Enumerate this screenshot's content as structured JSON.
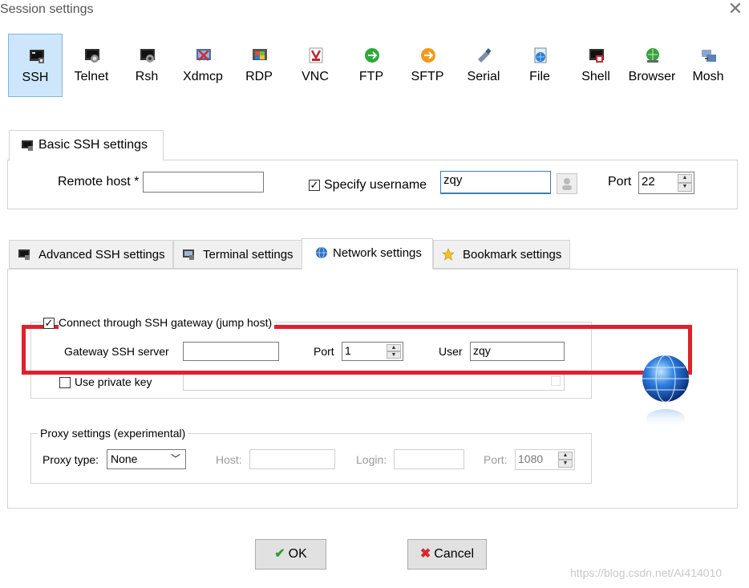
{
  "window": {
    "title": "Session settings"
  },
  "session_types": [
    {
      "label": "SSH",
      "icon": "ssh-terminal-icon",
      "selected": true
    },
    {
      "label": "Telnet",
      "icon": "telnet-icon"
    },
    {
      "label": "Rsh",
      "icon": "rsh-icon"
    },
    {
      "label": "Xdmcp",
      "icon": "xdmcp-icon"
    },
    {
      "label": "RDP",
      "icon": "rdp-icon"
    },
    {
      "label": "VNC",
      "icon": "vnc-icon"
    },
    {
      "label": "FTP",
      "icon": "ftp-icon"
    },
    {
      "label": "SFTP",
      "icon": "sftp-icon"
    },
    {
      "label": "Serial",
      "icon": "serial-icon"
    },
    {
      "label": "File",
      "icon": "file-icon"
    },
    {
      "label": "Shell",
      "icon": "shell-icon"
    },
    {
      "label": "Browser",
      "icon": "browser-icon"
    },
    {
      "label": "Mosh",
      "icon": "mosh-icon"
    }
  ],
  "basic": {
    "tab_label": "Basic SSH settings",
    "remote_host_label": "Remote host *",
    "remote_host_value": "",
    "specify_username_label": "Specify username",
    "specify_username_checked": true,
    "username_value": "zqy",
    "port_label": "Port",
    "port_value": "22"
  },
  "tabs": [
    {
      "label": "Advanced SSH settings",
      "icon": "terminal-icon"
    },
    {
      "label": "Terminal settings",
      "icon": "monitor-icon"
    },
    {
      "label": "Network settings",
      "icon": "globe-icon",
      "active": true
    },
    {
      "label": "Bookmark settings",
      "icon": "star-icon"
    }
  ],
  "network": {
    "gateway_checkbox_label": "Connect through SSH gateway (jump host)",
    "gateway_checked": true,
    "gateway_server_label": "Gateway SSH server",
    "gateway_server_value": "",
    "gateway_port_label": "Port",
    "gateway_port_value": "1",
    "gateway_user_label": "User",
    "gateway_user_value": "zqy",
    "private_key_label": "Use private key",
    "private_key_checked": false,
    "proxy_group_label": "Proxy settings (experimental)",
    "proxy_type_label": "Proxy type:",
    "proxy_type_value": "None",
    "host_label": "Host:",
    "login_label": "Login:",
    "proxy_port_label": "Port:",
    "proxy_port_value": "1080"
  },
  "buttons": {
    "ok": "OK",
    "cancel": "Cancel"
  },
  "watermark": "https://blog.csdn.net/AI414010",
  "colors": {
    "selected_bg": "#cde6fb",
    "highlight_red": "#e0202b",
    "ok_green": "#2ea12e",
    "cancel_red": "#d9272e"
  }
}
